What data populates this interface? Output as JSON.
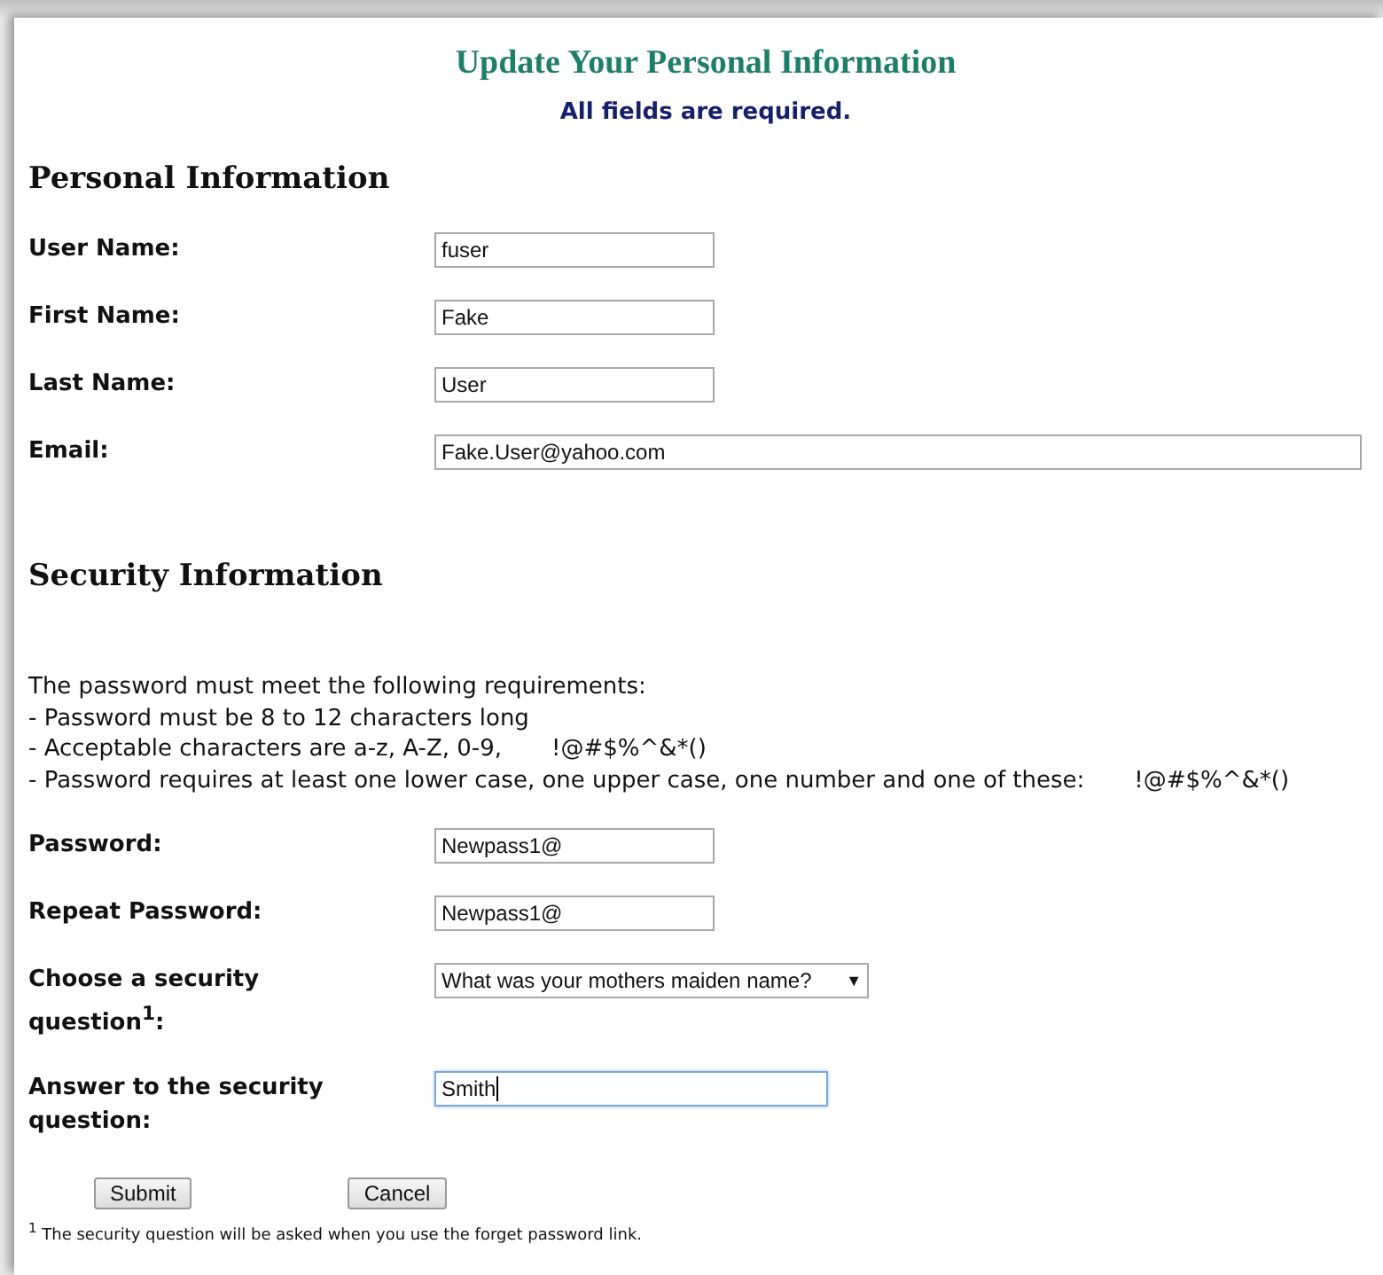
{
  "title": "Update Your Personal Information",
  "subtitle": "All fields are required.",
  "personal": {
    "heading": "Personal Information",
    "fields": [
      {
        "label": "User Name:",
        "kind": "text",
        "value": "fuser"
      },
      {
        "label": "First Name:",
        "kind": "text",
        "value": "Fake"
      },
      {
        "label": "Last Name:",
        "kind": "text",
        "value": "User"
      },
      {
        "label": "Email:",
        "kind": "email",
        "value": "Fake.User@yahoo.com"
      }
    ]
  },
  "security": {
    "heading": "Security Information",
    "requirements_intro": "The password must meet the following requirements:",
    "requirements": [
      {
        "text": "- Password must be 8 to 12 characters long"
      },
      {
        "text": "- Acceptable characters are a-z, A-Z, 0-9,",
        "symbols": "!@#$%^&*()"
      },
      {
        "text": "- Password requires at least one lower case, one upper case, one number and one of these:",
        "symbols": "!@#$%^&*()"
      }
    ],
    "fields": [
      {
        "label": "Password:",
        "kind": "password",
        "value": "Newpass1@",
        "focused": false
      },
      {
        "label": "Repeat Password:",
        "kind": "password",
        "value": "Newpass1@",
        "focused": false
      },
      {
        "label": "Choose a security question$^{1}$:",
        "kind": "select",
        "value": "What was your mothers maiden name?",
        "caret": "▼",
        "focused": false
      },
      {
        "label": "Answer to the security question:",
        "kind": "answer",
        "value": "Smith",
        "focused": true
      }
    ]
  },
  "buttons": [
    "Submit",
    "Cancel"
  ],
  "footnote": "$^{1}$ The security question will be asked when you use the forget password link."
}
